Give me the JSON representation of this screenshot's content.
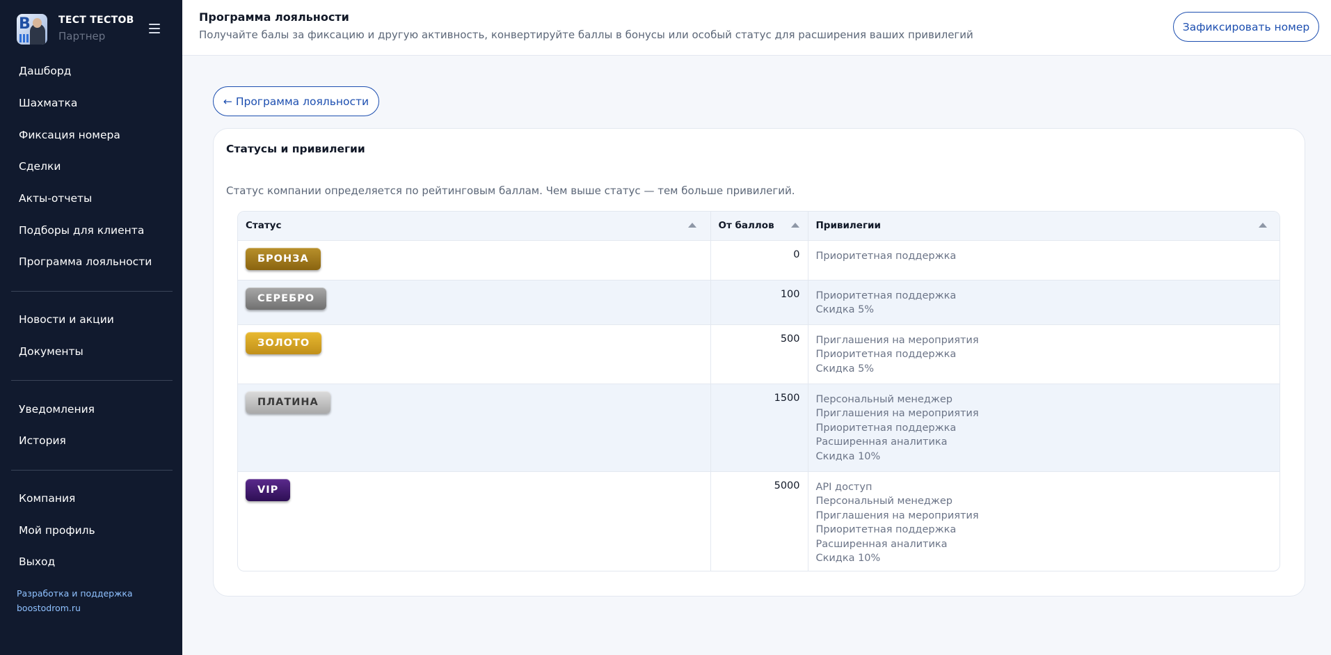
{
  "sidebar": {
    "profile": {
      "name": "ТЕСТ ТЕСТОВ",
      "role": "Партнер"
    },
    "menu_group_1": [
      "Дашборд",
      "Шахматка",
      "Фиксация номера",
      "Сделки",
      "Акты-отчеты",
      "Подборы для клиента",
      "Программа лояльности"
    ],
    "menu_group_2": [
      "Новости и акции",
      "Документы"
    ],
    "menu_group_3": [
      "Уведомления",
      "История"
    ],
    "menu_group_4": [
      "Компания",
      "Мой профиль",
      "Выход"
    ],
    "footer": {
      "line1": "Разработка и поддержка",
      "line2": "boostodrom.ru"
    }
  },
  "header": {
    "title": "Программа лояльности",
    "subtitle": "Получайте балы за фиксацию и другую активность, конвертируйте баллы в бонусы или особый статус для расширения ваших привилегий",
    "fix_button": "Зафиксировать номер"
  },
  "back_button": "← Программа лояльности",
  "card": {
    "title": "Статусы и привилегии",
    "description": "Статус компании определяется по рейтинговым баллам. Чем выше статус — тем больше привилегий."
  },
  "table": {
    "columns": [
      "Статус",
      "От баллов",
      "Привилегии"
    ],
    "rows": [
      {
        "status": "БРОНЗА",
        "points": "0",
        "privileges": [
          "Приоритетная поддержка"
        ]
      },
      {
        "status": "СЕРЕБРО",
        "points": "100",
        "privileges": [
          "Приоритетная поддержка",
          "Скидка 5%"
        ]
      },
      {
        "status": "ЗОЛОТО",
        "points": "500",
        "privileges": [
          "Приглашения на мероприятия",
          "Приоритетная поддержка",
          "Скидка 5%"
        ]
      },
      {
        "status": "ПЛАТИНА",
        "points": "1500",
        "privileges": [
          "Персональный менеджер",
          "Приглашения на мероприятия",
          "Приоритетная поддержка",
          "Расширенная аналитика",
          "Скидка 10%"
        ]
      },
      {
        "status": "VIP",
        "points": "5000",
        "privileges": [
          "API доступ",
          "Персональный менеджер",
          "Приглашения на мероприятия",
          "Приоритетная поддержка",
          "Расширенная аналитика",
          "Скидка 10%"
        ]
      }
    ]
  },
  "colors": {
    "sidebar_bg": "#111a2e",
    "accent": "#1d4fb0",
    "bronze": "#8a6410",
    "silver": "#707070",
    "gold": "#c1901a",
    "platinum": "#a9a9a9",
    "vip": "#2e0f55"
  },
  "icons": {
    "menu": "hamburger-icon",
    "sort": "sort-up-icon",
    "avatar": "user-avatar"
  }
}
